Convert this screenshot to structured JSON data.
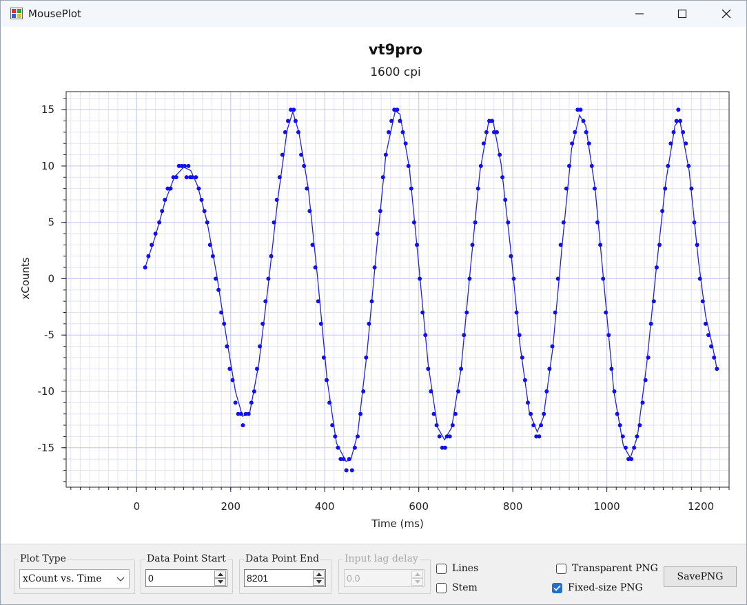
{
  "window": {
    "title": "MousePlot"
  },
  "chart_data": {
    "type": "scatter",
    "title": "vt9pro",
    "subtitle": "1600 cpi",
    "xlabel": "Time (ms)",
    "ylabel": "xCounts",
    "xlim": [
      -150,
      1260
    ],
    "ylim": [
      -18.5,
      16.6
    ],
    "xticks": [
      0,
      200,
      400,
      600,
      800,
      1000,
      1200
    ],
    "yticks": [
      15,
      10,
      5,
      0,
      -5,
      -10,
      -15
    ],
    "grid": true,
    "series": [
      {
        "style": "points",
        "color": "#1010ee",
        "points": [
          [
            18,
            1
          ],
          [
            25,
            2
          ],
          [
            32,
            3
          ],
          [
            40,
            4
          ],
          [
            48,
            5
          ],
          [
            54,
            6
          ],
          [
            60,
            7
          ],
          [
            66,
            8
          ],
          [
            72,
            8
          ],
          [
            78,
            9
          ],
          [
            84,
            9
          ],
          [
            90,
            10
          ],
          [
            96,
            10
          ],
          [
            102,
            10
          ],
          [
            106,
            9
          ],
          [
            110,
            10
          ],
          [
            114,
            9
          ],
          [
            118,
            9
          ],
          [
            126,
            9
          ],
          [
            132,
            8
          ],
          [
            138,
            7
          ],
          [
            144,
            6
          ],
          [
            150,
            5
          ],
          [
            156,
            3
          ],
          [
            162,
            2
          ],
          [
            168,
            0
          ],
          [
            174,
            -1
          ],
          [
            180,
            -3
          ],
          [
            186,
            -4
          ],
          [
            192,
            -6
          ],
          [
            198,
            -8
          ],
          [
            204,
            -9
          ],
          [
            210,
            -11
          ],
          [
            216,
            -12
          ],
          [
            222,
            -12
          ],
          [
            226,
            -13
          ],
          [
            232,
            -12
          ],
          [
            238,
            -12
          ],
          [
            244,
            -11
          ],
          [
            250,
            -10
          ],
          [
            256,
            -8
          ],
          [
            262,
            -6
          ],
          [
            268,
            -4
          ],
          [
            274,
            -2
          ],
          [
            280,
            0
          ],
          [
            286,
            2
          ],
          [
            292,
            5
          ],
          [
            298,
            7
          ],
          [
            304,
            9
          ],
          [
            310,
            11
          ],
          [
            316,
            13
          ],
          [
            322,
            14
          ],
          [
            328,
            15
          ],
          [
            334,
            15
          ],
          [
            338,
            14
          ],
          [
            344,
            13
          ],
          [
            350,
            11
          ],
          [
            356,
            10
          ],
          [
            362,
            8
          ],
          [
            368,
            6
          ],
          [
            374,
            3
          ],
          [
            380,
            1
          ],
          [
            386,
            -2
          ],
          [
            392,
            -4
          ],
          [
            398,
            -7
          ],
          [
            404,
            -9
          ],
          [
            410,
            -11
          ],
          [
            416,
            -13
          ],
          [
            422,
            -14
          ],
          [
            428,
            -15
          ],
          [
            434,
            -16
          ],
          [
            440,
            -16
          ],
          [
            446,
            -17
          ],
          [
            452,
            -16
          ],
          [
            458,
            -17
          ],
          [
            464,
            -15
          ],
          [
            470,
            -14
          ],
          [
            476,
            -12
          ],
          [
            482,
            -10
          ],
          [
            488,
            -7
          ],
          [
            494,
            -4
          ],
          [
            500,
            -2
          ],
          [
            506,
            1
          ],
          [
            512,
            4
          ],
          [
            518,
            6
          ],
          [
            524,
            9
          ],
          [
            530,
            11
          ],
          [
            536,
            13
          ],
          [
            542,
            14
          ],
          [
            548,
            15
          ],
          [
            554,
            15
          ],
          [
            560,
            14
          ],
          [
            566,
            13
          ],
          [
            572,
            12
          ],
          [
            578,
            10
          ],
          [
            584,
            8
          ],
          [
            590,
            5
          ],
          [
            596,
            3
          ],
          [
            602,
            0
          ],
          [
            608,
            -3
          ],
          [
            614,
            -5
          ],
          [
            620,
            -8
          ],
          [
            626,
            -10
          ],
          [
            632,
            -12
          ],
          [
            638,
            -13
          ],
          [
            644,
            -14
          ],
          [
            650,
            -15
          ],
          [
            656,
            -15
          ],
          [
            660,
            -14
          ],
          [
            666,
            -14
          ],
          [
            672,
            -13
          ],
          [
            678,
            -12
          ],
          [
            684,
            -10
          ],
          [
            690,
            -8
          ],
          [
            696,
            -5
          ],
          [
            702,
            -3
          ],
          [
            708,
            0
          ],
          [
            714,
            3
          ],
          [
            720,
            5
          ],
          [
            726,
            8
          ],
          [
            732,
            10
          ],
          [
            738,
            12
          ],
          [
            744,
            13
          ],
          [
            750,
            14
          ],
          [
            756,
            14
          ],
          [
            760,
            13
          ],
          [
            766,
            13
          ],
          [
            772,
            11
          ],
          [
            778,
            9
          ],
          [
            784,
            7
          ],
          [
            790,
            5
          ],
          [
            796,
            2
          ],
          [
            802,
            0
          ],
          [
            808,
            -3
          ],
          [
            814,
            -5
          ],
          [
            820,
            -7
          ],
          [
            826,
            -9
          ],
          [
            832,
            -11
          ],
          [
            838,
            -12
          ],
          [
            844,
            -13
          ],
          [
            850,
            -14
          ],
          [
            856,
            -14
          ],
          [
            860,
            -13
          ],
          [
            866,
            -12
          ],
          [
            872,
            -10
          ],
          [
            878,
            -8
          ],
          [
            884,
            -6
          ],
          [
            890,
            -3
          ],
          [
            896,
            0
          ],
          [
            902,
            3
          ],
          [
            908,
            5
          ],
          [
            914,
            8
          ],
          [
            920,
            10
          ],
          [
            926,
            12
          ],
          [
            932,
            13
          ],
          [
            938,
            15
          ],
          [
            944,
            15
          ],
          [
            950,
            14
          ],
          [
            956,
            13
          ],
          [
            962,
            12
          ],
          [
            968,
            10
          ],
          [
            974,
            8
          ],
          [
            980,
            5
          ],
          [
            986,
            3
          ],
          [
            992,
            0
          ],
          [
            998,
            -3
          ],
          [
            1004,
            -5
          ],
          [
            1010,
            -8
          ],
          [
            1016,
            -10
          ],
          [
            1022,
            -12
          ],
          [
            1028,
            -13
          ],
          [
            1034,
            -14
          ],
          [
            1040,
            -15
          ],
          [
            1046,
            -16
          ],
          [
            1052,
            -16
          ],
          [
            1058,
            -15
          ],
          [
            1064,
            -14
          ],
          [
            1070,
            -13
          ],
          [
            1076,
            -11
          ],
          [
            1082,
            -9
          ],
          [
            1088,
            -7
          ],
          [
            1094,
            -4
          ],
          [
            1100,
            -2
          ],
          [
            1106,
            1
          ],
          [
            1112,
            3
          ],
          [
            1118,
            6
          ],
          [
            1124,
            8
          ],
          [
            1130,
            10
          ],
          [
            1136,
            12
          ],
          [
            1142,
            13
          ],
          [
            1148,
            14
          ],
          [
            1152,
            15
          ],
          [
            1156,
            14
          ],
          [
            1162,
            13
          ],
          [
            1168,
            12
          ],
          [
            1174,
            10
          ],
          [
            1180,
            8
          ],
          [
            1186,
            5
          ],
          [
            1192,
            3
          ],
          [
            1198,
            0
          ],
          [
            1204,
            -2
          ],
          [
            1210,
            -4
          ],
          [
            1216,
            -5
          ],
          [
            1222,
            -6
          ],
          [
            1228,
            -7
          ],
          [
            1234,
            -8
          ]
        ]
      },
      {
        "style": "line",
        "color": "#2222dd",
        "points": [
          [
            18,
            1
          ],
          [
            40,
            3.8
          ],
          [
            60,
            6.8
          ],
          [
            80,
            9
          ],
          [
            100,
            9.9
          ],
          [
            115,
            9.6
          ],
          [
            130,
            8.2
          ],
          [
            150,
            5
          ],
          [
            170,
            0.4
          ],
          [
            190,
            -5
          ],
          [
            210,
            -10
          ],
          [
            225,
            -12.2
          ],
          [
            240,
            -12
          ],
          [
            260,
            -7.5
          ],
          [
            280,
            -0.5
          ],
          [
            300,
            7
          ],
          [
            320,
            13.2
          ],
          [
            332,
            14.8
          ],
          [
            345,
            13
          ],
          [
            365,
            8
          ],
          [
            385,
            0
          ],
          [
            405,
            -9
          ],
          [
            425,
            -14.6
          ],
          [
            445,
            -16.2
          ],
          [
            455,
            -16.1
          ],
          [
            470,
            -13.8
          ],
          [
            490,
            -6.5
          ],
          [
            510,
            2.5
          ],
          [
            530,
            11
          ],
          [
            550,
            14.9
          ],
          [
            560,
            14.6
          ],
          [
            580,
            9.8
          ],
          [
            600,
            1.2
          ],
          [
            620,
            -7.6
          ],
          [
            640,
            -13.2
          ],
          [
            655,
            -14.3
          ],
          [
            670,
            -13.2
          ],
          [
            690,
            -8
          ],
          [
            710,
            1
          ],
          [
            730,
            9.5
          ],
          [
            748,
            13.8
          ],
          [
            758,
            14
          ],
          [
            775,
            10.2
          ],
          [
            795,
            2.8
          ],
          [
            815,
            -5.8
          ],
          [
            835,
            -11.8
          ],
          [
            852,
            -13.6
          ],
          [
            865,
            -12.3
          ],
          [
            885,
            -6.2
          ],
          [
            905,
            3
          ],
          [
            925,
            11.5
          ],
          [
            942,
            14.5
          ],
          [
            955,
            13.6
          ],
          [
            975,
            8
          ],
          [
            995,
            -1
          ],
          [
            1015,
            -10
          ],
          [
            1035,
            -14.8
          ],
          [
            1050,
            -15.9
          ],
          [
            1065,
            -14
          ],
          [
            1085,
            -7.5
          ],
          [
            1105,
            0.8
          ],
          [
            1125,
            8.5
          ],
          [
            1145,
            13.6
          ],
          [
            1155,
            14.1
          ],
          [
            1175,
            9.6
          ],
          [
            1195,
            1.5
          ],
          [
            1210,
            -3.3
          ],
          [
            1225,
            -6
          ],
          [
            1234,
            -8
          ]
        ]
      }
    ]
  },
  "controls": {
    "plot_type": {
      "label": "Plot Type",
      "value": "xCount vs. Time"
    },
    "dp_start": {
      "label": "Data Point Start",
      "value": "0"
    },
    "dp_end": {
      "label": "Data Point End",
      "value": "8201"
    },
    "input_lag": {
      "label": "Input lag delay",
      "value": "0.0"
    },
    "lines": {
      "label": "Lines",
      "checked": false
    },
    "stem": {
      "label": "Stem",
      "checked": false
    },
    "transparent_png": {
      "label": "Transparent PNG",
      "checked": false
    },
    "fixed_size_png": {
      "label": "Fixed-size PNG",
      "checked": true
    },
    "save_png": {
      "label": "SavePNG"
    }
  }
}
